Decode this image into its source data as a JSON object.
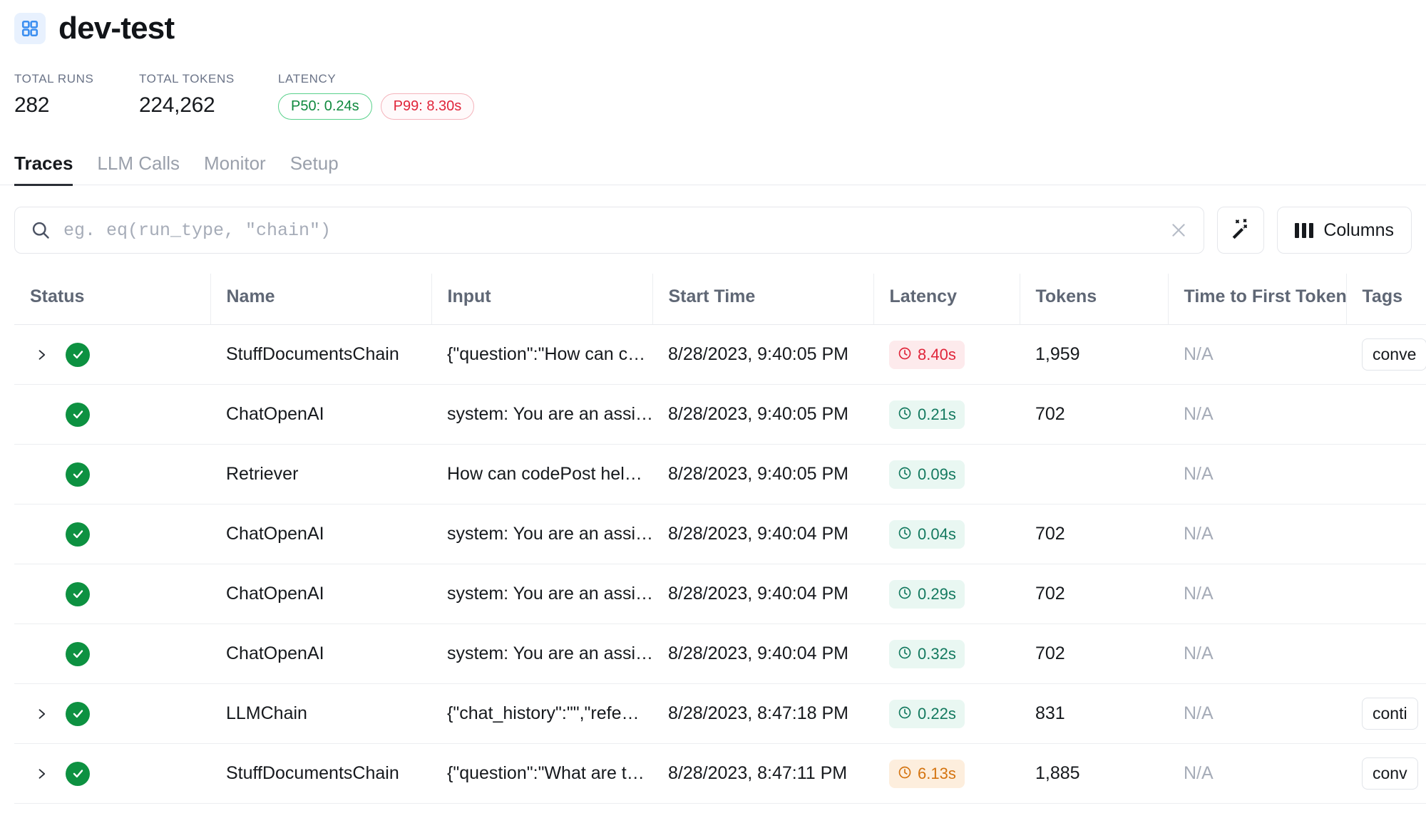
{
  "header": {
    "logo_icon": "grid-2x2-icon",
    "title": "dev-test"
  },
  "stats": {
    "total_runs": {
      "label": "TOTAL RUNS",
      "value": "282"
    },
    "total_tokens": {
      "label": "TOTAL TOKENS",
      "value": "224,262"
    },
    "latency": {
      "label": "LATENCY",
      "p50": "P50: 0.24s",
      "p99": "P99: 8.30s",
      "p50_color": "#10893e",
      "p99_color": "#e0253a"
    }
  },
  "tabs": [
    {
      "label": "Traces",
      "active": true
    },
    {
      "label": "LLM Calls",
      "active": false
    },
    {
      "label": "Monitor",
      "active": false
    },
    {
      "label": "Setup",
      "active": false
    }
  ],
  "toolbar": {
    "search_icon": "search-icon",
    "search_value": "",
    "search_placeholder": "eg. eq(run_type, \"chain\")",
    "clear_icon": "close-icon",
    "magic_icon": "magic-wand-icon",
    "columns_icon": "columns-icon",
    "columns_label": "Columns"
  },
  "table": {
    "columns": [
      "Status",
      "Name",
      "Input",
      "Start Time",
      "Latency",
      "Tokens",
      "Time to First Token",
      "Tags"
    ],
    "rows": [
      {
        "expandable": true,
        "status": "success",
        "name": "StuffDocumentsChain",
        "input": "{\"question\":\"How can c…",
        "start_time": "8/28/2023, 9:40:05 PM",
        "latency": "8.40s",
        "latency_level": "red",
        "tokens": "1,959",
        "ttft": "N/A",
        "tag": "conve"
      },
      {
        "expandable": false,
        "status": "success",
        "name": "ChatOpenAI",
        "input": "system: You are an assi…",
        "start_time": "8/28/2023, 9:40:05 PM",
        "latency": "0.21s",
        "latency_level": "green",
        "tokens": "702",
        "ttft": "N/A",
        "tag": ""
      },
      {
        "expandable": false,
        "status": "success",
        "name": "Retriever",
        "input": "How can codePost hel…",
        "start_time": "8/28/2023, 9:40:05 PM",
        "latency": "0.09s",
        "latency_level": "green",
        "tokens": "",
        "ttft": "N/A",
        "tag": ""
      },
      {
        "expandable": false,
        "status": "success",
        "name": "ChatOpenAI",
        "input": "system: You are an assi…",
        "start_time": "8/28/2023, 9:40:04 PM",
        "latency": "0.04s",
        "latency_level": "green",
        "tokens": "702",
        "ttft": "N/A",
        "tag": ""
      },
      {
        "expandable": false,
        "status": "success",
        "name": "ChatOpenAI",
        "input": "system: You are an assi…",
        "start_time": "8/28/2023, 9:40:04 PM",
        "latency": "0.29s",
        "latency_level": "green",
        "tokens": "702",
        "ttft": "N/A",
        "tag": ""
      },
      {
        "expandable": false,
        "status": "success",
        "name": "ChatOpenAI",
        "input": "system: You are an assi…",
        "start_time": "8/28/2023, 9:40:04 PM",
        "latency": "0.32s",
        "latency_level": "green",
        "tokens": "702",
        "ttft": "N/A",
        "tag": ""
      },
      {
        "expandable": true,
        "status": "success",
        "name": "LLMChain",
        "input": "{\"chat_history\":\"\",\"refe…",
        "start_time": "8/28/2023, 8:47:18 PM",
        "latency": "0.22s",
        "latency_level": "green",
        "tokens": "831",
        "ttft": "N/A",
        "tag": "conti"
      },
      {
        "expandable": true,
        "status": "success",
        "name": "StuffDocumentsChain",
        "input": "{\"question\":\"What are t…",
        "start_time": "8/28/2023, 8:47:11 PM",
        "latency": "6.13s",
        "latency_level": "orange",
        "tokens": "1,885",
        "ttft": "N/A",
        "tag": "conv"
      }
    ]
  }
}
